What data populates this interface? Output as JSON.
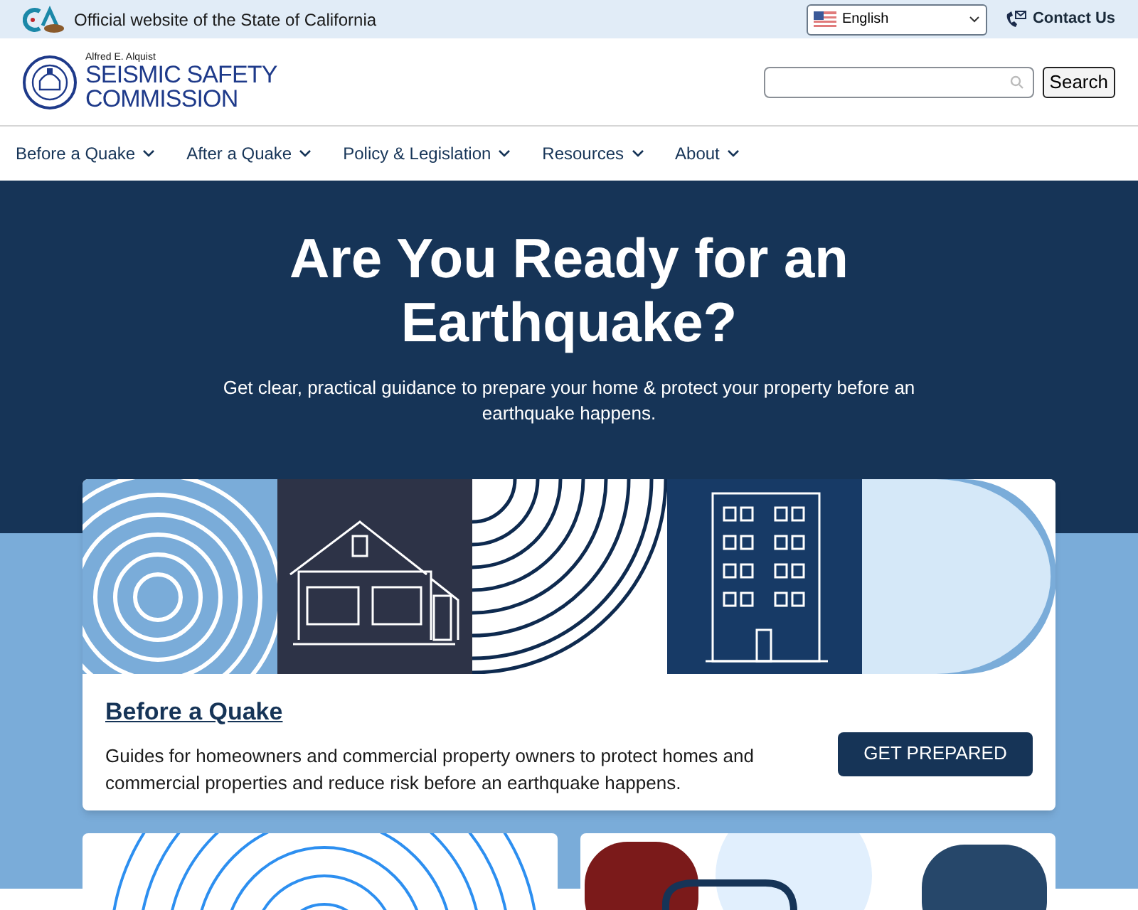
{
  "top_bar": {
    "text": "Official website of the State of California",
    "language": "English",
    "contact": "Contact Us"
  },
  "header": {
    "logo_small": "Alfred E. Alquist",
    "logo_line_1": "SEISMIC SAFETY",
    "logo_line_2": "COMMISSION",
    "search_button": "Search"
  },
  "nav": [
    {
      "label": "Before a Quake"
    },
    {
      "label": "After a Quake"
    },
    {
      "label": "Policy & Legislation"
    },
    {
      "label": "Resources"
    },
    {
      "label": "About"
    }
  ],
  "hero": {
    "title": "Are You Ready for an Earthquake?",
    "subtitle": "Get clear, practical guidance to prepare your home & protect your property before an earthquake happens."
  },
  "feature_card": {
    "title": "Before a Quake",
    "description": "Guides for homeowners and commercial property owners to protect homes and commercial properties and reduce risk before an earthquake happens.",
    "button": "GET PREPARED"
  }
}
